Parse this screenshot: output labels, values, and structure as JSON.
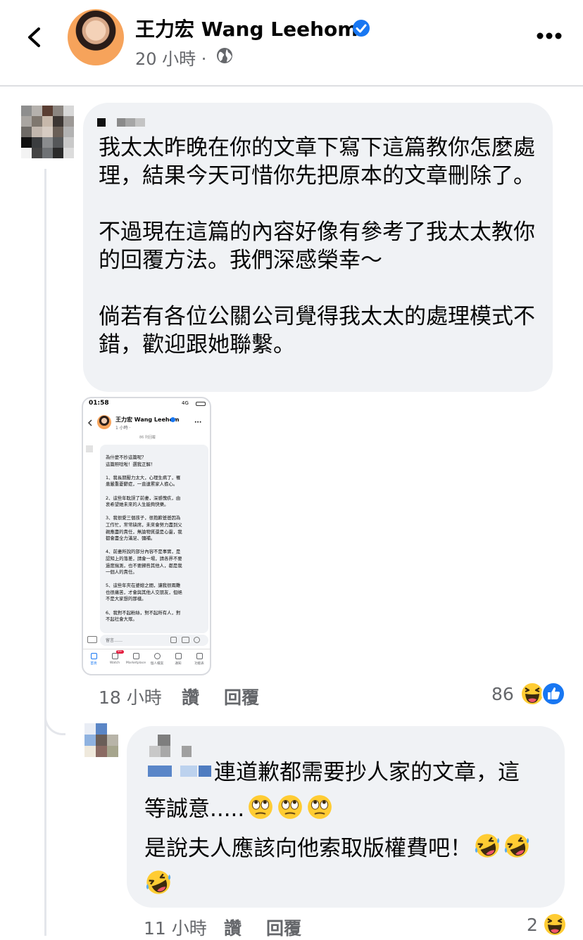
{
  "header": {
    "page_name": "王力宏 Wang Leehom",
    "post_time": "20 小時 ·"
  },
  "comment": {
    "text": "我太太昨晚在你的文章下寫下這篇教你怎麼處理，結果今天可惜你先把原本的文章刪除了。\n\n不過現在這篇的內容好像有參考了我太太教你的回覆方法。我們深感榮幸～\n\n倘若有各位公關公司覺得我太太的處理模式不錯，歡迎跟她聯繫。",
    "time": "18 小時",
    "like_label": "讚",
    "reply_label": "回覆",
    "reaction_count": "86"
  },
  "attached_screenshot": {
    "status_time": "01:58",
    "status_signal": "4G",
    "page_name": "王力宏 Wang Leehom",
    "post_time": "1 小時 ·",
    "replies_label": "86 則回覆",
    "lines": [
      "為什麼不抄這篇呢？",
      "這篇照唸啦！選我正解！",
      "",
      "1、我長期壓力太大，心理生病了，罹",
      "患嚴重憂鬱症，一直連累家人擔心。",
      "",
      "2、這些年耽誤了前妻，深感愧疚，由",
      "衷希望她未來的人生能夠快樂。",
      "",
      "3、我很愛三個孩子，很抱歉爸爸因為",
      "工作忙，常常缺席，未來會努力盡到父",
      "親應盡的責任，無論物質還是心靈，我",
      "都會盡全力滿足、彌補。",
      "",
      "4、前妻所說的部分內容不是事實，是",
      "認知上的落差，請會一場，請各界不要",
      "過度揣測，也不要歸咎其他人，都是我",
      "一個人的責任。",
      "",
      "5、這些年夾在婆媳之間，讓我很兩難",
      "也很痛苦，才會與其他人交朋友，但絕",
      "不是大家想的那樣。",
      "",
      "6、我對不起粉絲，對不起所有人，對",
      "不起社會大眾。"
    ],
    "comment_placeholder": "留言……",
    "nav": [
      "首頁",
      "Watch",
      "Marketplace",
      "個人檔案",
      "通知",
      "功能表"
    ],
    "watch_badge": "9+"
  },
  "reply": {
    "line1": "連道歉都需要抄人家的文章，這",
    "line2": "等誠意.....",
    "line3": "是說夫人應該向他索取版權費吧！",
    "time": "11 小時",
    "like_label": "讚",
    "reply_label": "回覆",
    "reaction_count": "2"
  },
  "colors": {
    "bubble": "#f0f2f5",
    "secondary_text": "#65676b",
    "facebook_blue": "#1877f2",
    "emoji_yellow": "#ffcc33"
  },
  "icons": [
    "back-icon",
    "verified-icon",
    "globe-icon",
    "more-icon",
    "haha-reaction-icon",
    "like-reaction-icon",
    "face-with-rolling-eyes-emoji",
    "rolling-on-floor-laughing-emoji"
  ]
}
